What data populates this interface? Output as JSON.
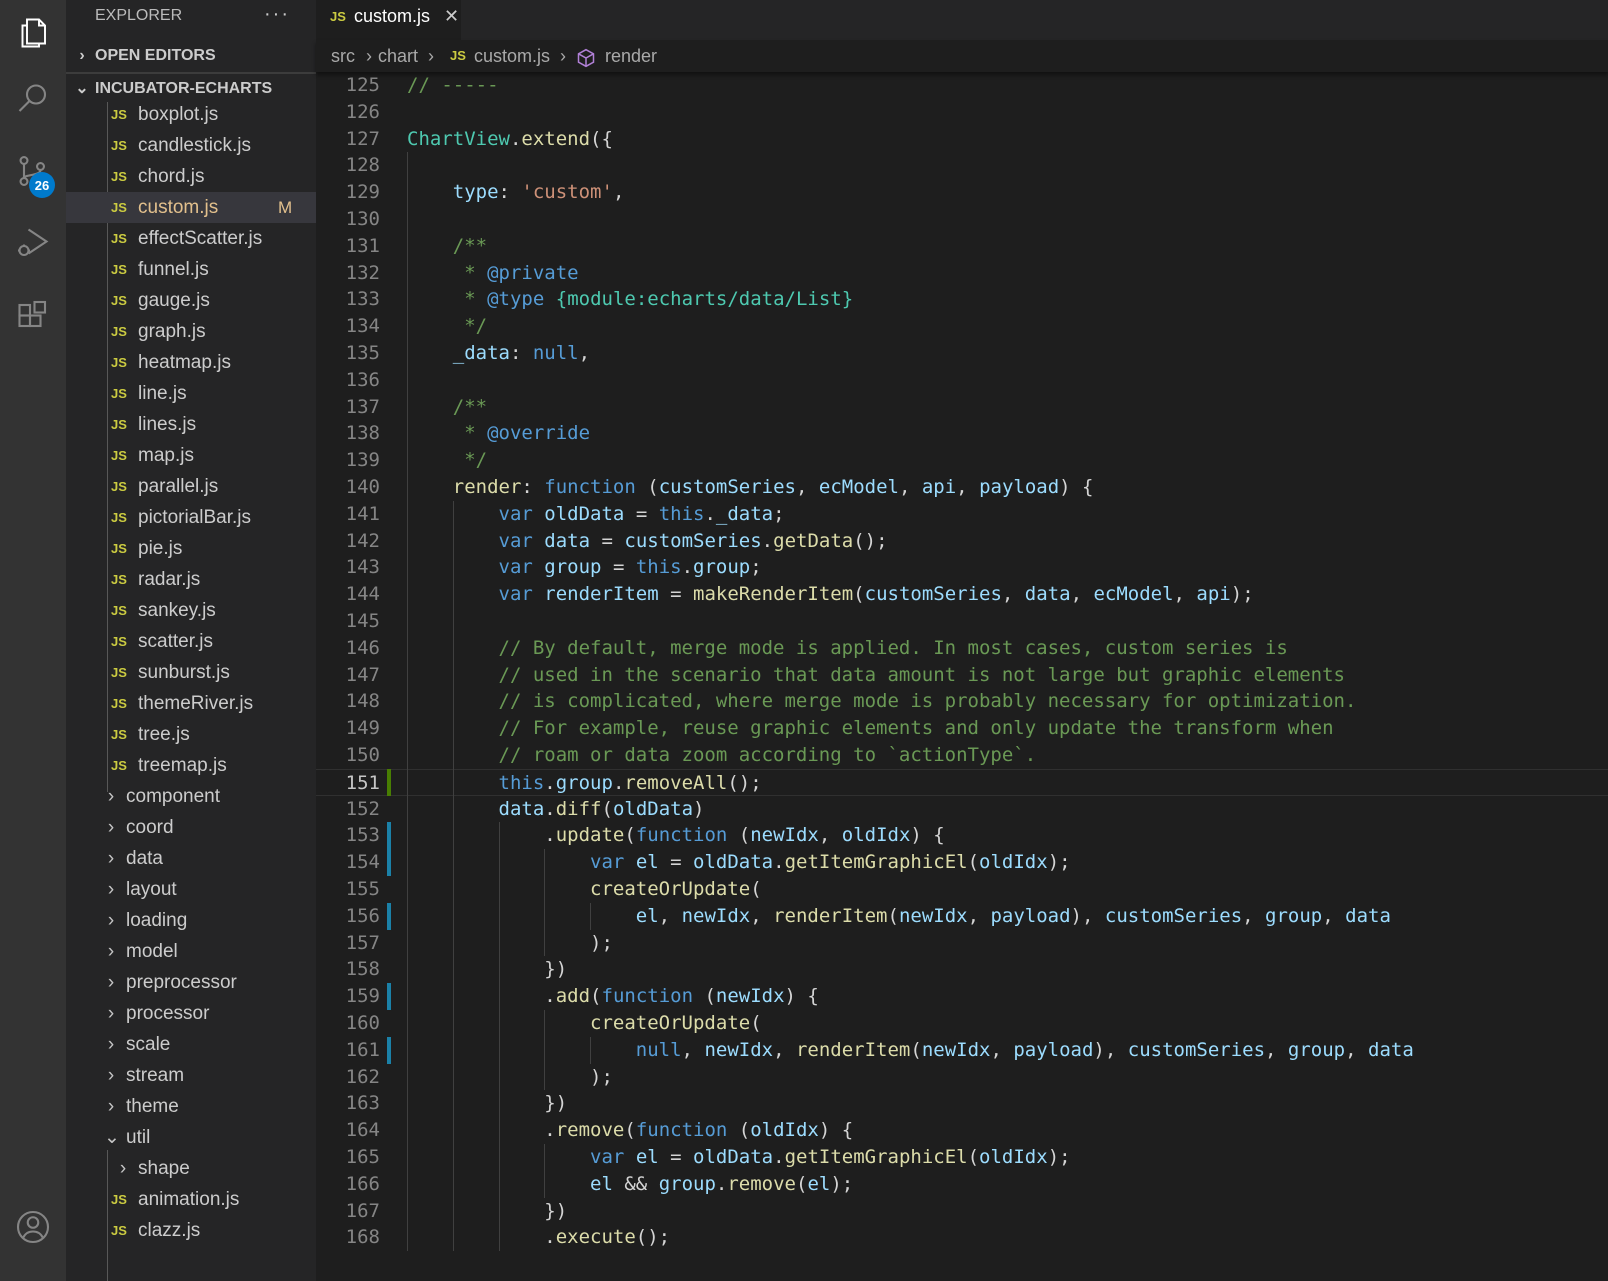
{
  "activity_bar": {
    "items": [
      "explorer-icon",
      "search-icon",
      "source-control-icon",
      "run-debug-icon",
      "extensions-icon",
      "account-icon"
    ],
    "source_control_badge": "26",
    "colors": {
      "bg": "#333333",
      "badge": "#007acc"
    }
  },
  "sidebar": {
    "title": "EXPLORER",
    "more": "···",
    "open_editors": "OPEN EDITORS",
    "project": "INCUBATOR-ECHARTS",
    "files": [
      "boxplot.js",
      "candlestick.js",
      "chord.js",
      "custom.js",
      "effectScatter.js",
      "funnel.js",
      "gauge.js",
      "graph.js",
      "heatmap.js",
      "line.js",
      "lines.js",
      "map.js",
      "parallel.js",
      "pictorialBar.js",
      "pie.js",
      "radar.js",
      "sankey.js",
      "scatter.js",
      "sunburst.js",
      "themeRiver.js",
      "tree.js",
      "treemap.js"
    ],
    "active_file": "custom.js",
    "modified_flag": "M",
    "folders": [
      "component",
      "coord",
      "data",
      "layout",
      "loading",
      "model",
      "preprocessor",
      "processor",
      "scale",
      "stream",
      "theme",
      "util"
    ],
    "util_children": {
      "folders": [
        "shape"
      ],
      "files": [
        "animation.js",
        "clazz.js"
      ]
    },
    "js_badge": "JS"
  },
  "editor": {
    "tab": {
      "label": "custom.js",
      "close": "✕"
    },
    "breadcrumb": [
      "src",
      "chart",
      "custom.js",
      "render"
    ],
    "first_line": 125,
    "current_line": 151,
    "lines": [
      [
        [
          "c",
          "// -----"
        ]
      ],
      [],
      [
        [
          "t",
          "ChartView"
        ],
        [
          "p",
          "."
        ],
        [
          "f",
          "extend"
        ],
        [
          "p",
          "({"
        ]
      ],
      [],
      [
        [
          "p",
          "    "
        ],
        [
          "v",
          "type"
        ],
        [
          "p",
          ": "
        ],
        [
          "s",
          "'custom'"
        ],
        [
          "p",
          ","
        ]
      ],
      [],
      [
        [
          "p",
          "    "
        ],
        [
          "c",
          "/**"
        ]
      ],
      [
        [
          "p",
          "     "
        ],
        [
          "c",
          "* "
        ],
        [
          "k",
          "@private"
        ]
      ],
      [
        [
          "p",
          "     "
        ],
        [
          "c",
          "* "
        ],
        [
          "k",
          "@type"
        ],
        [
          "p",
          " "
        ],
        [
          "t",
          "{module:echarts/data/List}"
        ]
      ],
      [
        [
          "p",
          "     "
        ],
        [
          "c",
          "*/"
        ]
      ],
      [
        [
          "p",
          "    "
        ],
        [
          "v",
          "_data"
        ],
        [
          "p",
          ": "
        ],
        [
          "k",
          "null"
        ],
        [
          "p",
          ","
        ]
      ],
      [],
      [
        [
          "p",
          "    "
        ],
        [
          "c",
          "/**"
        ]
      ],
      [
        [
          "p",
          "     "
        ],
        [
          "c",
          "* "
        ],
        [
          "k",
          "@override"
        ]
      ],
      [
        [
          "p",
          "     "
        ],
        [
          "c",
          "*/"
        ]
      ],
      [
        [
          "p",
          "    "
        ],
        [
          "f",
          "render"
        ],
        [
          "p",
          ": "
        ],
        [
          "k",
          "function"
        ],
        [
          "p",
          " ("
        ],
        [
          "v",
          "customSeries"
        ],
        [
          "p",
          ", "
        ],
        [
          "v",
          "ecModel"
        ],
        [
          "p",
          ", "
        ],
        [
          "v",
          "api"
        ],
        [
          "p",
          ", "
        ],
        [
          "v",
          "payload"
        ],
        [
          "p",
          ") {"
        ]
      ],
      [
        [
          "p",
          "        "
        ],
        [
          "k",
          "var"
        ],
        [
          "p",
          " "
        ],
        [
          "v",
          "oldData"
        ],
        [
          "p",
          " = "
        ],
        [
          "k",
          "this"
        ],
        [
          "p",
          "."
        ],
        [
          "v",
          "_data"
        ],
        [
          "p",
          ";"
        ]
      ],
      [
        [
          "p",
          "        "
        ],
        [
          "k",
          "var"
        ],
        [
          "p",
          " "
        ],
        [
          "v",
          "data"
        ],
        [
          "p",
          " = "
        ],
        [
          "v",
          "customSeries"
        ],
        [
          "p",
          "."
        ],
        [
          "f",
          "getData"
        ],
        [
          "p",
          "();"
        ]
      ],
      [
        [
          "p",
          "        "
        ],
        [
          "k",
          "var"
        ],
        [
          "p",
          " "
        ],
        [
          "v",
          "group"
        ],
        [
          "p",
          " = "
        ],
        [
          "k",
          "this"
        ],
        [
          "p",
          "."
        ],
        [
          "v",
          "group"
        ],
        [
          "p",
          ";"
        ]
      ],
      [
        [
          "p",
          "        "
        ],
        [
          "k",
          "var"
        ],
        [
          "p",
          " "
        ],
        [
          "v",
          "renderItem"
        ],
        [
          "p",
          " = "
        ],
        [
          "f",
          "makeRenderItem"
        ],
        [
          "p",
          "("
        ],
        [
          "v",
          "customSeries"
        ],
        [
          "p",
          ", "
        ],
        [
          "v",
          "data"
        ],
        [
          "p",
          ", "
        ],
        [
          "v",
          "ecModel"
        ],
        [
          "p",
          ", "
        ],
        [
          "v",
          "api"
        ],
        [
          "p",
          ");"
        ]
      ],
      [],
      [
        [
          "p",
          "        "
        ],
        [
          "c",
          "// By default, merge mode is applied. In most cases, custom series is"
        ]
      ],
      [
        [
          "p",
          "        "
        ],
        [
          "c",
          "// used in the scenario that data amount is not large but graphic elements"
        ]
      ],
      [
        [
          "p",
          "        "
        ],
        [
          "c",
          "// is complicated, where merge mode is probably necessary for optimization."
        ]
      ],
      [
        [
          "p",
          "        "
        ],
        [
          "c",
          "// For example, reuse graphic elements and only update the transform when"
        ]
      ],
      [
        [
          "p",
          "        "
        ],
        [
          "c",
          "// roam or data zoom according to `actionType`."
        ]
      ],
      [
        [
          "p",
          "        "
        ],
        [
          "k",
          "this"
        ],
        [
          "p",
          "."
        ],
        [
          "v",
          "group"
        ],
        [
          "p",
          "."
        ],
        [
          "f",
          "removeAll"
        ],
        [
          "p",
          "()"
        ],
        [
          "p",
          ";"
        ]
      ],
      [
        [
          "p",
          "        "
        ],
        [
          "v",
          "data"
        ],
        [
          "p",
          "."
        ],
        [
          "f",
          "diff"
        ],
        [
          "p",
          "("
        ],
        [
          "v",
          "oldData"
        ],
        [
          "p",
          ")"
        ]
      ],
      [
        [
          "p",
          "            ."
        ],
        [
          "f",
          "update"
        ],
        [
          "p",
          "("
        ],
        [
          "k",
          "function"
        ],
        [
          "p",
          " ("
        ],
        [
          "v",
          "newIdx"
        ],
        [
          "p",
          ", "
        ],
        [
          "v",
          "oldIdx"
        ],
        [
          "p",
          ") {"
        ]
      ],
      [
        [
          "p",
          "                "
        ],
        [
          "k",
          "var"
        ],
        [
          "p",
          " "
        ],
        [
          "v",
          "el"
        ],
        [
          "p",
          " = "
        ],
        [
          "v",
          "oldData"
        ],
        [
          "p",
          "."
        ],
        [
          "f",
          "getItemGraphicEl"
        ],
        [
          "p",
          "("
        ],
        [
          "v",
          "oldIdx"
        ],
        [
          "p",
          ");"
        ]
      ],
      [
        [
          "p",
          "                "
        ],
        [
          "f",
          "createOrUpdate"
        ],
        [
          "p",
          "("
        ]
      ],
      [
        [
          "p",
          "                    "
        ],
        [
          "v",
          "el"
        ],
        [
          "p",
          ", "
        ],
        [
          "v",
          "newIdx"
        ],
        [
          "p",
          ", "
        ],
        [
          "f",
          "renderItem"
        ],
        [
          "p",
          "("
        ],
        [
          "v",
          "newIdx"
        ],
        [
          "p",
          ", "
        ],
        [
          "v",
          "payload"
        ],
        [
          "p",
          "), "
        ],
        [
          "v",
          "customSeries"
        ],
        [
          "p",
          ", "
        ],
        [
          "v",
          "group"
        ],
        [
          "p",
          ", "
        ],
        [
          "v",
          "data"
        ]
      ],
      [
        [
          "p",
          "                );"
        ]
      ],
      [
        [
          "p",
          "            })"
        ]
      ],
      [
        [
          "p",
          "            ."
        ],
        [
          "f",
          "add"
        ],
        [
          "p",
          "("
        ],
        [
          "k",
          "function"
        ],
        [
          "p",
          " ("
        ],
        [
          "v",
          "newIdx"
        ],
        [
          "p",
          ") {"
        ]
      ],
      [
        [
          "p",
          "                "
        ],
        [
          "f",
          "createOrUpdate"
        ],
        [
          "p",
          "("
        ]
      ],
      [
        [
          "p",
          "                    "
        ],
        [
          "k",
          "null"
        ],
        [
          "p",
          ", "
        ],
        [
          "v",
          "newIdx"
        ],
        [
          "p",
          ", "
        ],
        [
          "f",
          "renderItem"
        ],
        [
          "p",
          "("
        ],
        [
          "v",
          "newIdx"
        ],
        [
          "p",
          ", "
        ],
        [
          "v",
          "payload"
        ],
        [
          "p",
          "), "
        ],
        [
          "v",
          "customSeries"
        ],
        [
          "p",
          ", "
        ],
        [
          "v",
          "group"
        ],
        [
          "p",
          ", "
        ],
        [
          "v",
          "data"
        ]
      ],
      [
        [
          "p",
          "                );"
        ]
      ],
      [
        [
          "p",
          "            })"
        ]
      ],
      [
        [
          "p",
          "            ."
        ],
        [
          "f",
          "remove"
        ],
        [
          "p",
          "("
        ],
        [
          "k",
          "function"
        ],
        [
          "p",
          " ("
        ],
        [
          "v",
          "oldIdx"
        ],
        [
          "p",
          ") {"
        ]
      ],
      [
        [
          "p",
          "                "
        ],
        [
          "k",
          "var"
        ],
        [
          "p",
          " "
        ],
        [
          "v",
          "el"
        ],
        [
          "p",
          " = "
        ],
        [
          "v",
          "oldData"
        ],
        [
          "p",
          "."
        ],
        [
          "f",
          "getItemGraphicEl"
        ],
        [
          "p",
          "("
        ],
        [
          "v",
          "oldIdx"
        ],
        [
          "p",
          ");"
        ]
      ],
      [
        [
          "p",
          "                "
        ],
        [
          "v",
          "el"
        ],
        [
          "p",
          " && "
        ],
        [
          "v",
          "group"
        ],
        [
          "p",
          "."
        ],
        [
          "f",
          "remove"
        ],
        [
          "p",
          "("
        ],
        [
          "v",
          "el"
        ],
        [
          "p",
          ");"
        ]
      ],
      [
        [
          "p",
          "            })"
        ]
      ],
      [
        [
          "p",
          "            ."
        ],
        [
          "f",
          "execute"
        ],
        [
          "p",
          "();"
        ]
      ]
    ],
    "gutter_modified_lines": [
      153,
      154,
      156,
      159,
      161
    ],
    "gutter_added_lines": [
      151
    ],
    "colors": {
      "keyword": "#569cd6",
      "function": "#dcdcaa",
      "variable": "#9cdcfe",
      "string": "#ce9178",
      "comment": "#6a9955",
      "type": "#4ec9b0"
    }
  }
}
